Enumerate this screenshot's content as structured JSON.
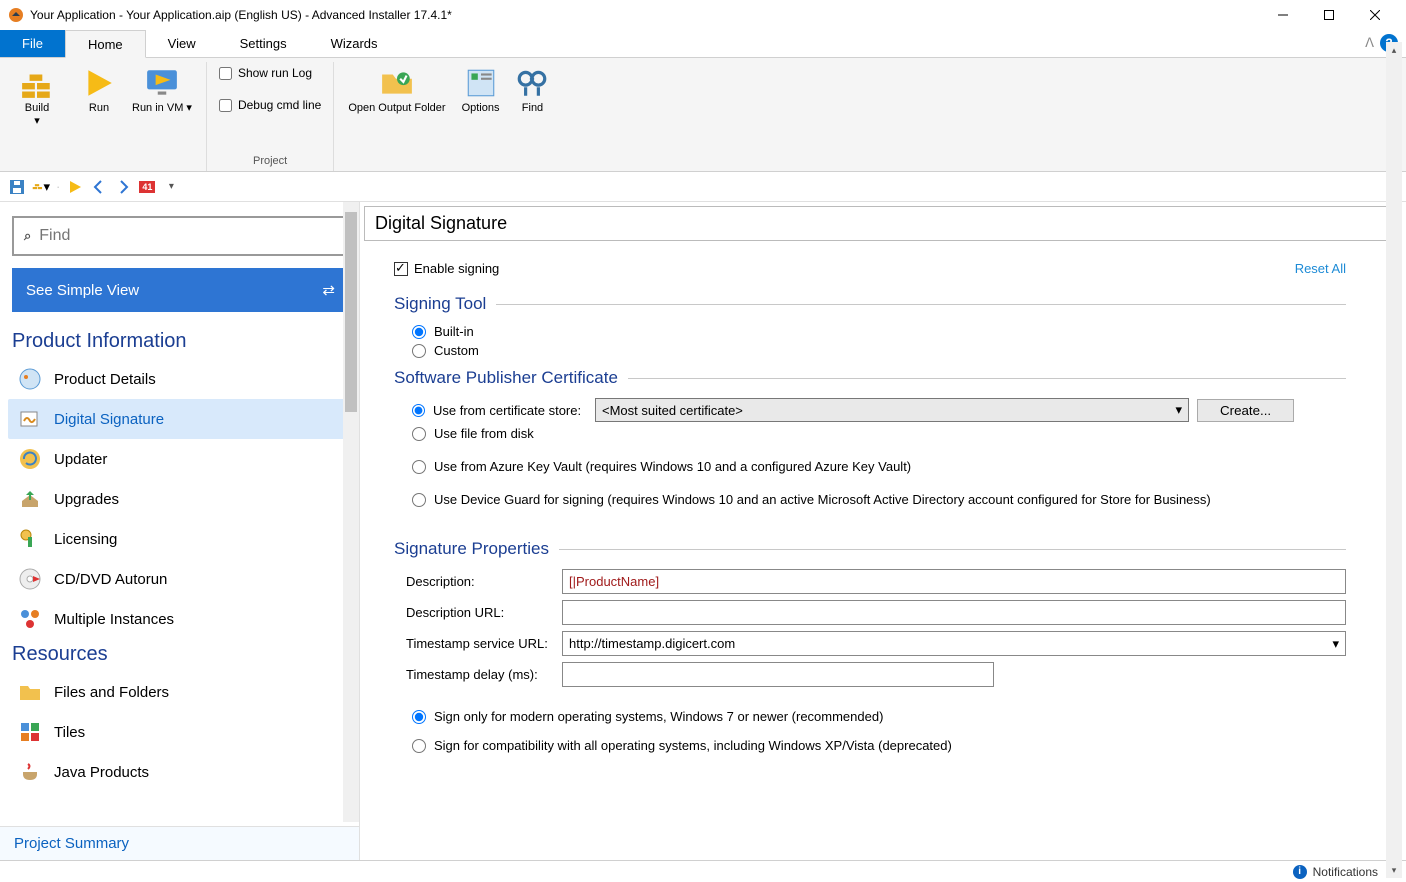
{
  "window": {
    "title": "Your Application - Your Application.aip (English US) - Advanced Installer 17.4.1*"
  },
  "menu": {
    "tabs": [
      "File",
      "Home",
      "View",
      "Settings",
      "Wizards"
    ],
    "active": "Home"
  },
  "ribbon": {
    "build": "Build",
    "run": "Run",
    "run_in_vm": "Run in VM",
    "show_run_log": "Show run Log",
    "debug_cmd": "Debug cmd line",
    "open_output": "Open Output Folder",
    "options": "Options",
    "find": "Find",
    "group_project": "Project"
  },
  "sidebar": {
    "find_placeholder": "Find",
    "simple_view": "See Simple View",
    "sections": {
      "product_info": "Product Information",
      "resources": "Resources"
    },
    "items": {
      "product_details": "Product Details",
      "digital_signature": "Digital Signature",
      "updater": "Updater",
      "upgrades": "Upgrades",
      "licensing": "Licensing",
      "cdvd": "CD/DVD Autorun",
      "multi_inst": "Multiple Instances",
      "files_folders": "Files and Folders",
      "tiles": "Tiles",
      "java": "Java Products"
    },
    "project_summary": "Project Summary",
    "badge": "41"
  },
  "content": {
    "title": "Digital Signature",
    "enable_signing": "Enable signing",
    "reset_all": "Reset All",
    "signing_tool_hdr": "Signing Tool",
    "builtin": "Built-in",
    "custom": "Custom",
    "spc_hdr": "Software Publisher Certificate",
    "use_from_store": "Use from certificate store:",
    "store_value": "<Most suited certificate>",
    "create_btn": "Create...",
    "use_file": "Use file from disk",
    "use_azure": "Use from Azure Key Vault (requires Windows 10 and a configured Azure Key Vault)",
    "use_device_guard": "Use Device Guard for signing (requires Windows 10 and an active Microsoft Active Directory account configured for Store for Business)",
    "sig_props_hdr": "Signature Properties",
    "desc_lbl": "Description:",
    "desc_val": "[|ProductName]",
    "desc_url_lbl": "Description URL:",
    "desc_url_val": "",
    "ts_url_lbl": "Timestamp service URL:",
    "ts_url_val": "http://timestamp.digicert.com",
    "ts_delay_lbl": "Timestamp delay (ms):",
    "ts_delay_val": "",
    "sign_modern": "Sign only for modern operating systems, Windows 7 or newer (recommended)",
    "sign_compat": "Sign for compatibility with all operating systems, including Windows XP/Vista (deprecated)"
  },
  "status": {
    "notifications": "Notifications"
  }
}
